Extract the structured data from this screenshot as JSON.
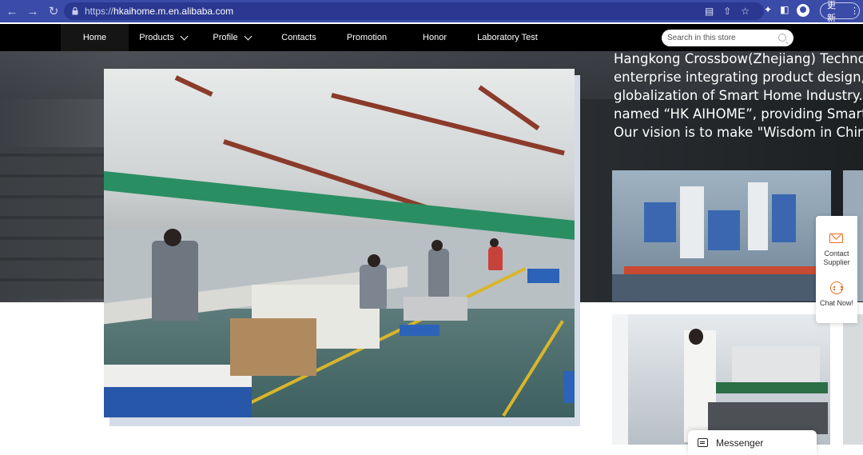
{
  "browser": {
    "url_scheme": "https://",
    "url_host": "hkaihome.m.en.alibaba.com",
    "update_label": "更新",
    "menu_glyph": "⋮"
  },
  "store_nav": {
    "items": [
      {
        "label": "Home",
        "active": true,
        "dropdown": false
      },
      {
        "label": "Products",
        "active": false,
        "dropdown": true
      },
      {
        "label": "Profile",
        "active": false,
        "dropdown": true
      },
      {
        "label": "Contacts",
        "active": false,
        "dropdown": false
      },
      {
        "label": "Promotion",
        "active": false,
        "dropdown": false
      },
      {
        "label": "Honor",
        "active": false,
        "dropdown": false
      },
      {
        "label": "Laboratory Test",
        "active": false,
        "dropdown": false
      }
    ],
    "search_placeholder": "Search in this store"
  },
  "intro": {
    "lines": [
      "Hangkong Crossbow(Zhejiang) Technology",
      "enterprise integrating product design, R&D,",
      "globalization of Smart Home Industry. Our g",
      "named “HK AIHOME”, providing Smart Ho",
      "Our vision is to make \"Wisdom in China\" in t"
    ]
  },
  "side_panel": {
    "contact_label_1": "Contact",
    "contact_label_2": "Supplier",
    "chat_label": "Chat Now!"
  },
  "messenger": {
    "label": "Messenger"
  },
  "colors": {
    "browser_bar": "#3a4ba8",
    "nav_bg": "#000000",
    "accent_orange": "#f06a1c"
  }
}
